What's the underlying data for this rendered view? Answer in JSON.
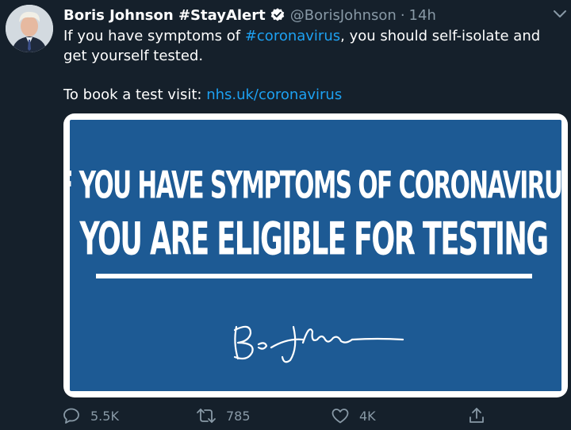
{
  "tweet": {
    "author_name": "Boris Johnson #StayAlert",
    "handle": "@BorisJohnson",
    "separator": "·",
    "time": "14h",
    "text_line1_before": "If you have symptoms of ",
    "hashtag": "#coronavirus",
    "text_line1_after": ", you should self-isolate and get yourself tested.",
    "text_line2_before": "To book a test visit: ",
    "link": "nhs.uk/coronavirus"
  },
  "media": {
    "line1": "IF YOU HAVE SYMPTOMS OF CORONAVIRUS",
    "line2": "YOU ARE ELIGIBLE FOR TESTING",
    "background_color": "#1d5a94"
  },
  "actions": {
    "replies": "5.5K",
    "retweets": "785",
    "likes": "4K",
    "share": ""
  },
  "colors": {
    "background": "#15202b",
    "accent": "#1da1f2",
    "muted": "#8899a6"
  },
  "icons": [
    "verified-badge-icon",
    "chevron-down-icon",
    "reply-icon",
    "retweet-icon",
    "like-icon",
    "share-icon"
  ]
}
